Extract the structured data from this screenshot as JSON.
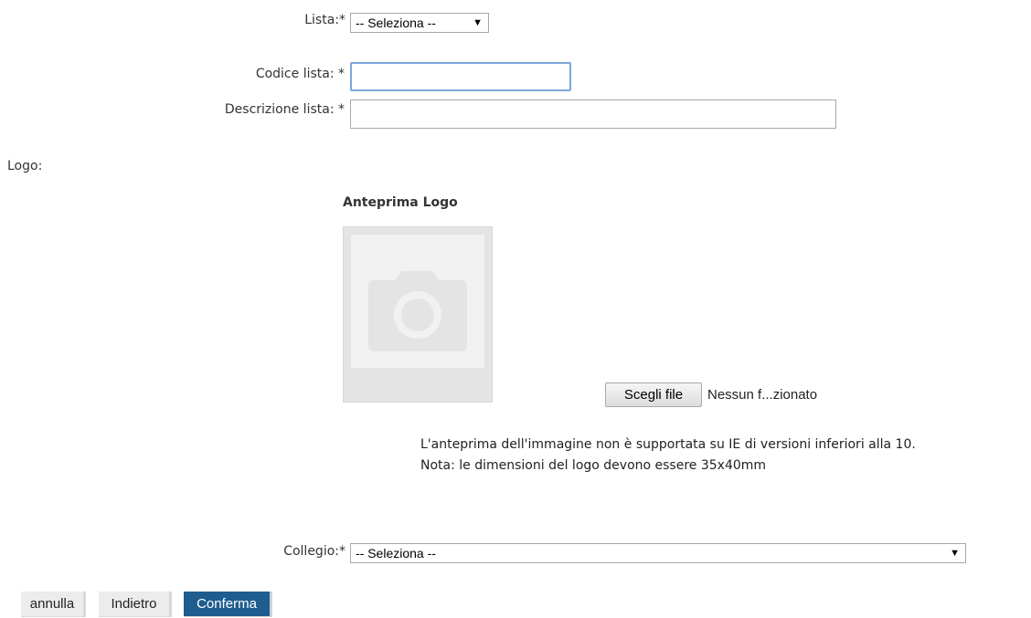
{
  "form": {
    "lista_label": "Lista:*",
    "lista_value": "-- Seleziona --",
    "codice_label": "Codice lista: *",
    "codice_value": "",
    "descrizione_label": "Descrizione lista: *",
    "descrizione_value": "",
    "logo_label": "Logo:",
    "preview_title": "Anteprima Logo",
    "file_button": "Scegli file",
    "file_name": "Nessun f...zionato",
    "note_line1": "L'anteprima dell'immagine non è supportata su IE di versioni inferiori alla 10.",
    "note_line2": "Nota: le dimensioni del logo devono essere 35x40mm",
    "collegio_label": "Collegio:*",
    "collegio_value": "-- Seleziona --"
  },
  "buttons": {
    "annulla": "annulla",
    "indietro": "Indietro",
    "conferma": "Conferma"
  },
  "icons": {
    "select_arrow": "dropdown-arrow-icon",
    "camera": "camera-icon"
  },
  "colors": {
    "primary_button": "#1f5d8f",
    "focus_border": "#7da7d9"
  }
}
